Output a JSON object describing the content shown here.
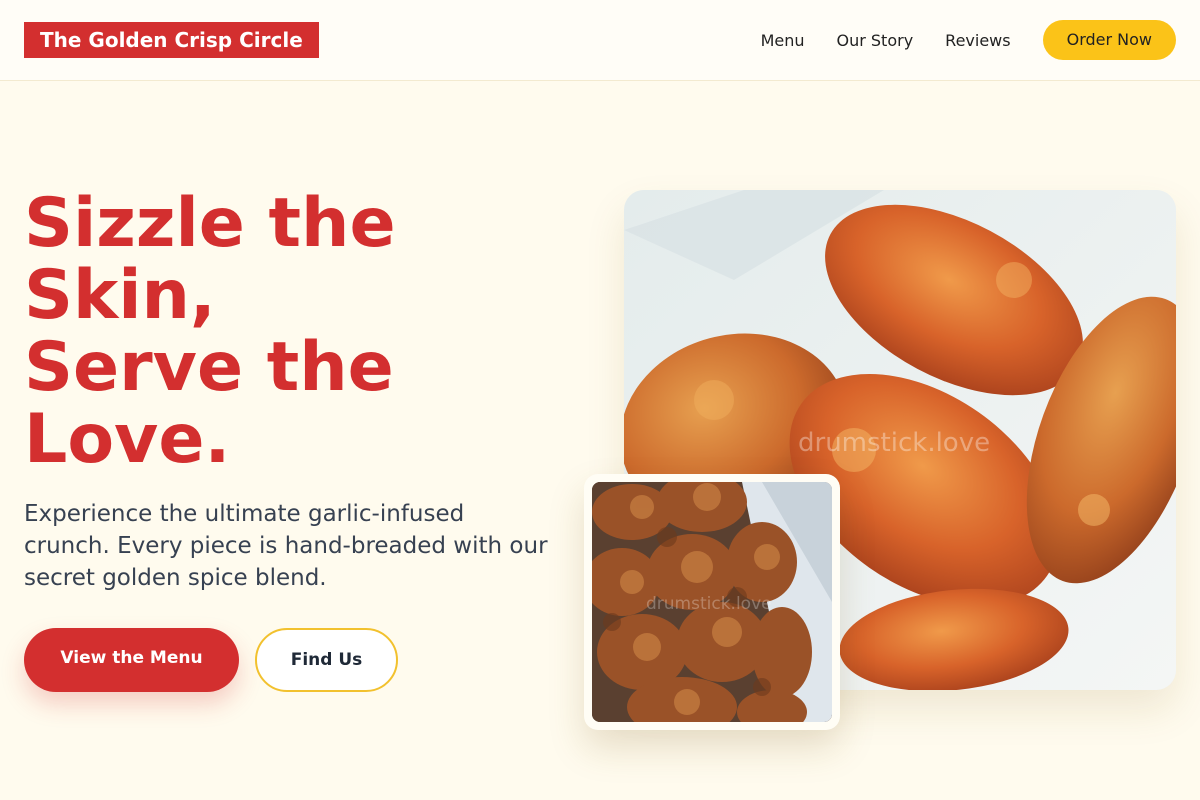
{
  "header": {
    "brand": "The Golden Crisp Circle",
    "nav": [
      {
        "label": "Menu"
      },
      {
        "label": "Our Story"
      },
      {
        "label": "Reviews"
      }
    ],
    "cta_label": "Order Now"
  },
  "hero": {
    "title_lines": [
      "Sizzle the",
      "Skin,",
      "Serve the",
      "Love."
    ],
    "description_lines": [
      "Experience the ultimate garlic-infused",
      "crunch. Every piece is hand-breaded with our",
      "secret golden spice blend."
    ],
    "primary_button": "View the Menu",
    "secondary_button": "Find Us"
  },
  "images": {
    "main_watermark": "drumstick.love",
    "thumb_watermark": "drumstick.love"
  },
  "colors": {
    "brand_red": "#d32f2f",
    "accent_yellow": "#fbc318",
    "page_background": "#fffbee"
  }
}
